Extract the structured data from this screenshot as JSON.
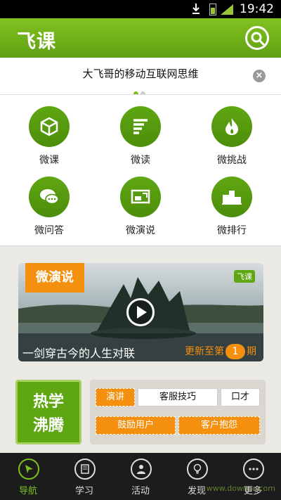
{
  "statusbar": {
    "time": "19:42"
  },
  "header": {
    "logo": "飞课",
    "search_icon": "search-icon"
  },
  "notice": {
    "text": "大飞哥的移动互联网思维",
    "page_count": 2,
    "active_page": 1
  },
  "features": [
    {
      "label": "微课",
      "icon": "cube-icon"
    },
    {
      "label": "微读",
      "icon": "text-lines-icon"
    },
    {
      "label": "微挑战",
      "icon": "flame-icon"
    },
    {
      "label": "微问答",
      "icon": "chat-bubble-icon"
    },
    {
      "label": "微演说",
      "icon": "screen-icon"
    },
    {
      "label": "微排行",
      "icon": "podium-icon"
    }
  ],
  "video": {
    "tag": "微演说",
    "brand": "飞课",
    "title": "一剑穿古今的人生对联",
    "update_prefix": "更新至第",
    "episode": "1",
    "update_suffix": "期"
  },
  "hot": {
    "title_line1": "热学",
    "title_line2": "沸腾",
    "tags": [
      "演讲",
      "客服技巧",
      "口才",
      "鼓励用户",
      "客户抱怨"
    ]
  },
  "nav": [
    {
      "label": "导航",
      "icon": "compass-icon",
      "active": true
    },
    {
      "label": "学习",
      "icon": "book-icon",
      "active": false
    },
    {
      "label": "活动",
      "icon": "person-icon",
      "active": false
    },
    {
      "label": "发现",
      "icon": "bulb-icon",
      "active": false
    },
    {
      "label": "更多",
      "icon": "more-icon",
      "active": false
    }
  ],
  "watermark": "www.downcc.com",
  "colors": {
    "brand_green": "#5fa712",
    "accent_orange": "#f58f0e"
  }
}
